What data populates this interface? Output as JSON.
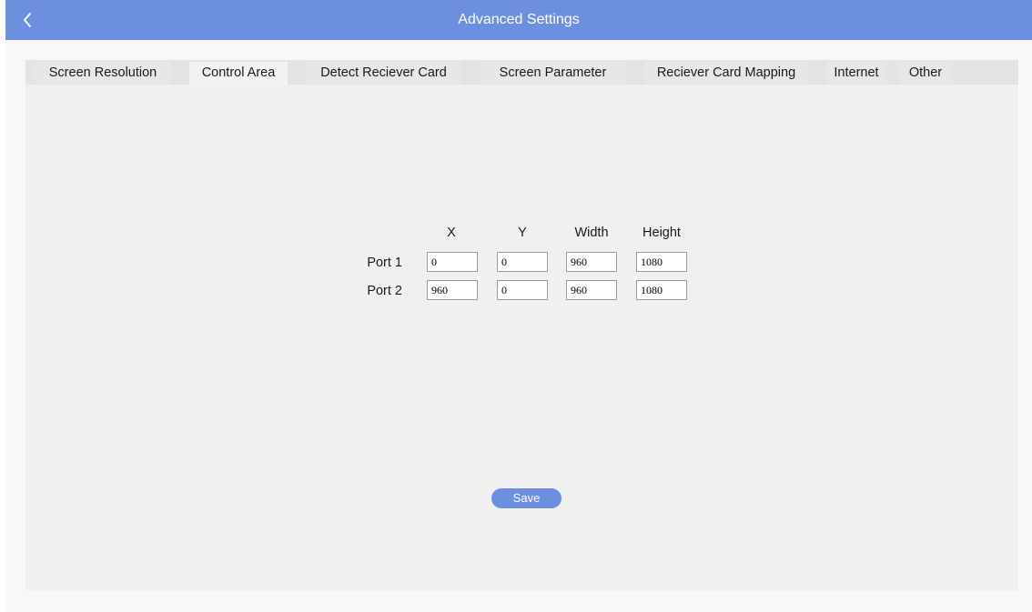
{
  "header": {
    "title": "Advanced Settings",
    "back_icon": "chevron-left-icon",
    "color": "#6d8fe0"
  },
  "tabs": [
    {
      "label": "Screen Resolution",
      "active": false
    },
    {
      "label": "Control Area",
      "active": true
    },
    {
      "label": "Detect Reciever Card",
      "active": false
    },
    {
      "label": "Screen Parameter",
      "active": false
    },
    {
      "label": "Reciever Card Mapping",
      "active": false
    },
    {
      "label": "Internet",
      "active": false
    },
    {
      "label": "Other",
      "active": false
    }
  ],
  "control_area": {
    "columns": [
      "X",
      "Y",
      "Width",
      "Height"
    ],
    "ports": [
      {
        "label": "Port 1",
        "values": [
          "0",
          "0",
          "960",
          "1080"
        ]
      },
      {
        "label": "Port 2",
        "values": [
          "960",
          "0",
          "960",
          "1080"
        ]
      }
    ]
  },
  "save_label": "Save"
}
